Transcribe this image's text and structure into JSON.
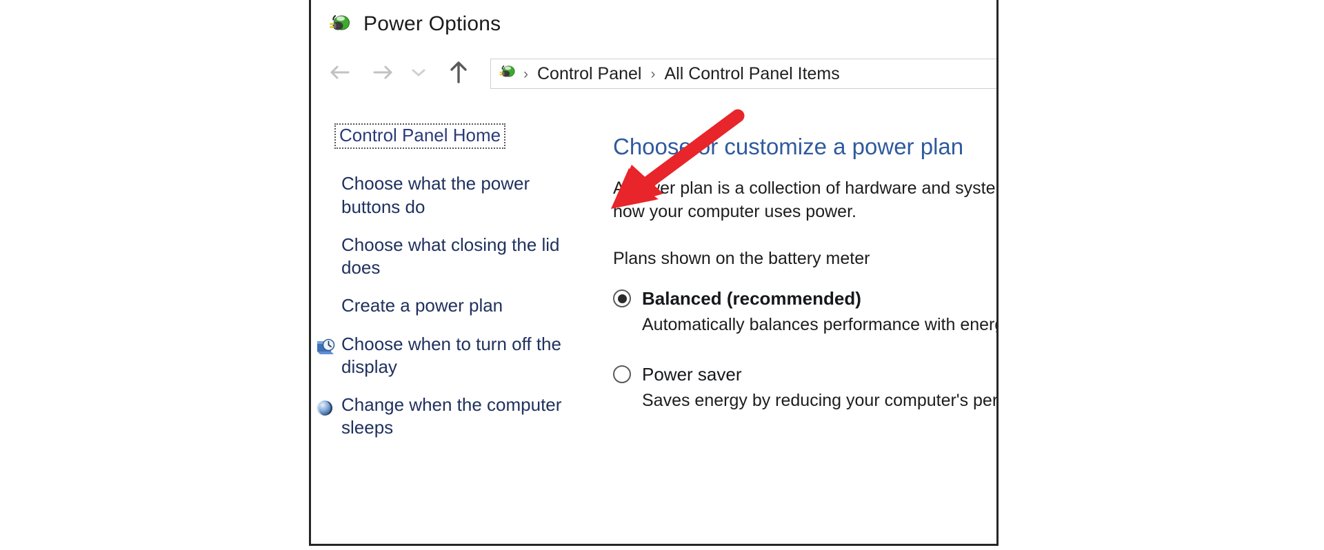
{
  "window": {
    "title": "Power Options",
    "title_icon": "power-plug-icon"
  },
  "navigation": {
    "back_icon": "arrow-left-icon",
    "forward_icon": "arrow-right-icon",
    "recent_icon": "chevron-down-icon",
    "up_icon": "arrow-up-icon",
    "address_icon": "power-plug-icon",
    "breadcrumb": [
      {
        "label": "Control Panel"
      },
      {
        "label": "All Control Panel Items"
      }
    ],
    "separator": "›"
  },
  "task_pane": {
    "home_link": "Control Panel Home",
    "items": [
      {
        "label": "Choose what the power buttons do",
        "icon": null
      },
      {
        "label": "Choose what closing the lid does",
        "icon": null
      },
      {
        "label": "Create a power plan",
        "icon": null
      },
      {
        "label": "Choose when to turn off the display",
        "icon": "monitor-clock-icon"
      },
      {
        "label": "Change when the computer sleeps",
        "icon": "sleep-moon-icon"
      }
    ]
  },
  "content": {
    "heading": "Choose or customize a power plan",
    "paragraph_line1": "A power plan is a collection of hardware and system settings that manages",
    "paragraph_line2": "how your computer uses power.",
    "plans_label": "Plans shown on the battery meter",
    "plans": [
      {
        "name": "Balanced (recommended)",
        "description": "Automatically balances performance with energy consumption on capable hardware.",
        "selected": true
      },
      {
        "name": "Power saver",
        "description": "Saves energy by reducing your computer's performance where possible.",
        "selected": false
      }
    ]
  },
  "annotation": {
    "arrow_color": "#e8252a",
    "arrow_name": "red-pointer-arrow",
    "points_to": "Choose what the power buttons do"
  },
  "colors": {
    "link": "#20315f",
    "heading": "#2f5a9e",
    "window_border": "#262626",
    "accent_red": "#e8252a"
  }
}
